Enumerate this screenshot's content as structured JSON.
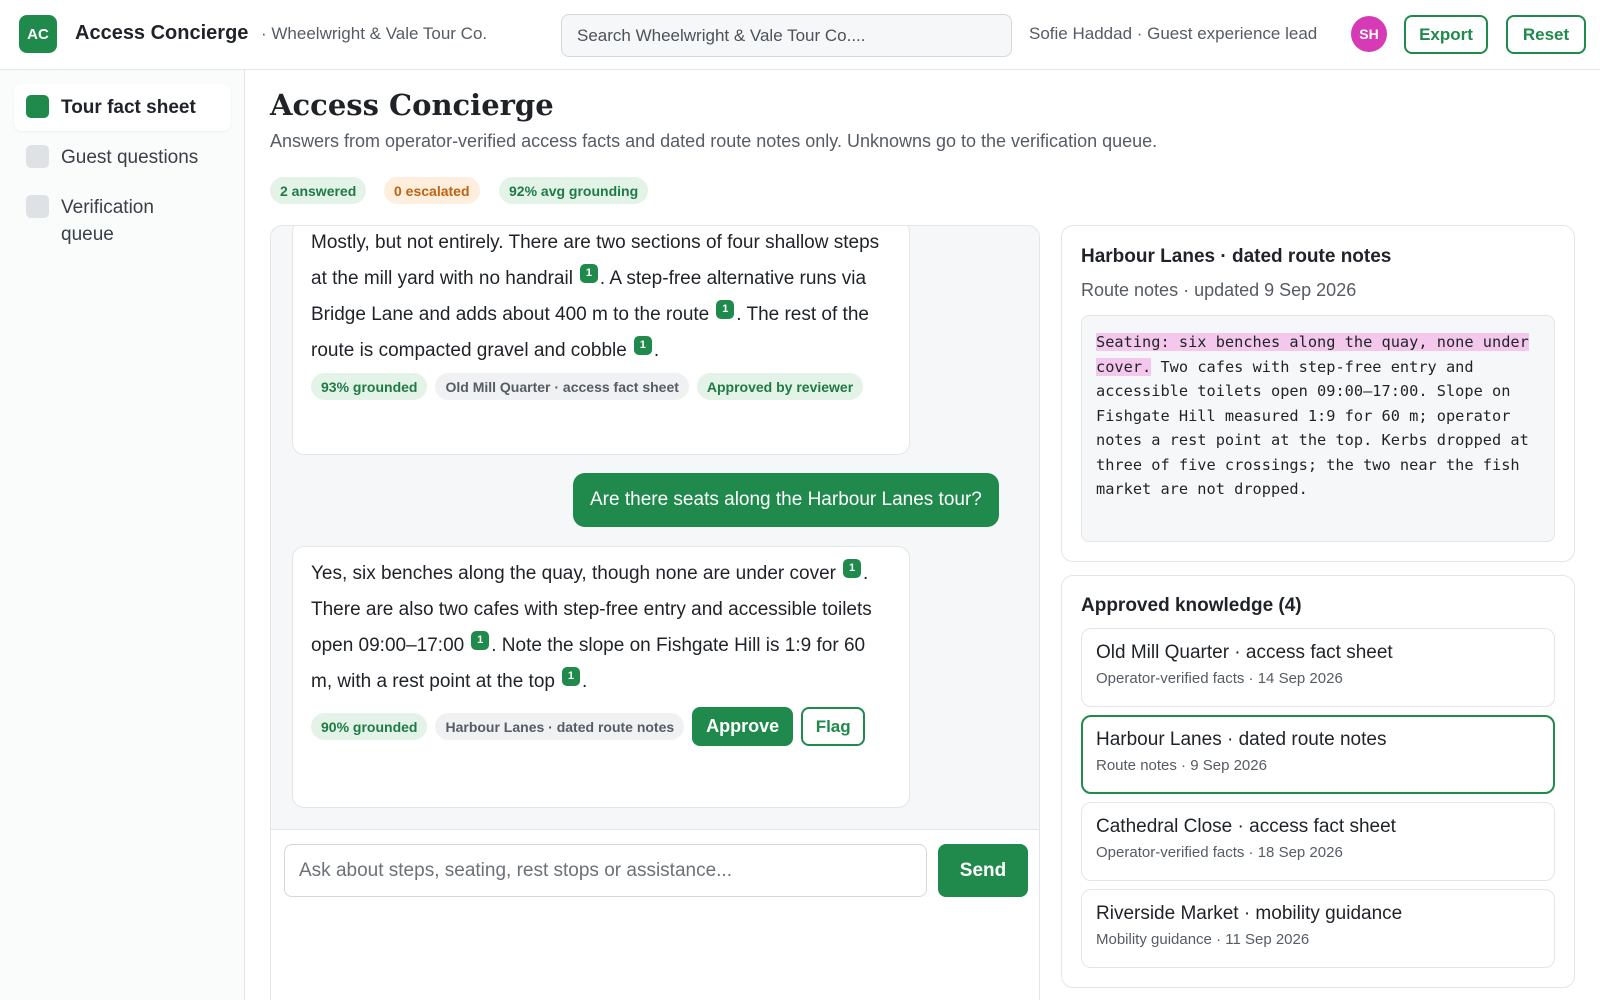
{
  "header": {
    "logo_initials": "AC",
    "app_title": "Access Concierge",
    "org_name": "· Wheelwright & Vale Tour Co.",
    "search_placeholder": "Search Wheelwright & Vale Tour Co....",
    "user_label": "Sofie Haddad · Guest experience lead",
    "avatar_initials": "SH",
    "export_label": "Export",
    "reset_label": "Reset"
  },
  "sidebar": {
    "items": [
      {
        "label": "Tour fact sheet",
        "active": true
      },
      {
        "label": "Guest questions",
        "active": false
      },
      {
        "label": "Verification queue",
        "active": false
      }
    ]
  },
  "main": {
    "title": "Access Concierge",
    "subtitle": "Answers from operator-verified access facts and dated route notes only. Unknowns go to the verification queue.",
    "stats": [
      "2 answered",
      "0 escalated",
      "92% avg grounding"
    ]
  },
  "chat": {
    "messages": [
      {
        "role": "assistant",
        "segments": [
          "Mostly, but not entirely. There are two sections of four shallow steps at the mill yard with no handrail",
          ". A step-free alternative runs via Bridge Lane and adds about 400 m to the route",
          ". The rest of the route is compacted gravel and cobble",
          "."
        ],
        "citations": [
          "1",
          "1",
          "1"
        ],
        "grounded": "93% grounded",
        "source": "Old Mill Quarter · access fact sheet",
        "status": "Approved by reviewer"
      },
      {
        "role": "user",
        "text": "Are there seats along the Harbour Lanes tour?"
      },
      {
        "role": "assistant",
        "segments": [
          "Yes, six benches along the quay, though none are under cover",
          ". There are also two cafes with step-free entry and accessible toilets open 09:00–17:00",
          ". Note the slope on Fishgate Hill is 1:9 for 60 m, with a rest point at the top",
          "."
        ],
        "citations": [
          "1",
          "1",
          "1"
        ],
        "grounded": "90% grounded",
        "source": "Harbour Lanes · dated route notes",
        "approve_label": "Approve",
        "flag_label": "Flag"
      }
    ],
    "composer_placeholder": "Ask about steps, seating, rest stops or assistance...",
    "send_label": "Send"
  },
  "route_notes": {
    "title": "Harbour Lanes · dated route notes",
    "meta": "Route notes · updated 9 Sep 2026",
    "highlight": "Seating: six benches along the quay, none under cover.",
    "body": " Two cafes with step-free entry and accessible toilets open 09:00–17:00. Slope on Fishgate Hill measured 1:9 for 60 m; operator notes a rest point at the top. Kerbs dropped at three of five crossings; the two near the fish market are not dropped."
  },
  "knowledge": {
    "title": "Approved knowledge (4)",
    "items": [
      {
        "title": "Old Mill Quarter · access fact sheet",
        "meta": "Operator-verified facts · 14 Sep 2026",
        "selected": false
      },
      {
        "title": "Harbour Lanes · dated route notes",
        "meta": "Route notes · 9 Sep 2026",
        "selected": true
      },
      {
        "title": "Cathedral Close · access fact sheet",
        "meta": "Operator-verified facts · 18 Sep 2026",
        "selected": false
      },
      {
        "title": "Riverside Market · mobility guidance",
        "meta": "Mobility guidance · 11 Sep 2026",
        "selected": false
      }
    ]
  },
  "colors": {
    "accent": "#1f8a4c",
    "avatar": "#d63bb5",
    "highlight": "#f3c8ec",
    "escalated": "#c0620f"
  }
}
